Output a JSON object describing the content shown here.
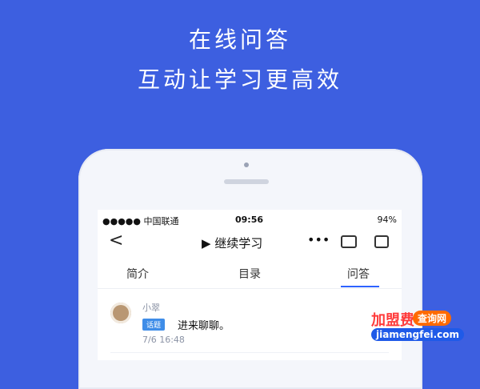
{
  "hero": {
    "line1": "在线问答",
    "line2": "互动让学习更高效"
  },
  "status_bar": {
    "carrier": "●●●●● 中国联通",
    "time": "09:56",
    "right": "94%"
  },
  "nav": {
    "back": "<",
    "play_title": "▶ 继续学习",
    "more": "•••"
  },
  "tabs": [
    "简介",
    "目录",
    "问答"
  ],
  "post": {
    "author": "小翠",
    "tag": "话题",
    "content": "进来聊聊。",
    "datetime": "7/6  16:48"
  },
  "watermark": {
    "top_text": "加盟费",
    "pill_text": "查询网",
    "bottom_text": "jiamengfei.com"
  },
  "colors": {
    "background": "#3d5fe0",
    "accent": "#2e63ff",
    "tag": "#3f8de8"
  },
  "icons": {
    "back": "back-icon",
    "more": "more-icon",
    "chat": "chat-icon",
    "share": "share-icon",
    "play": "play-icon",
    "wifi": "wifi-icon",
    "battery": "battery-icon"
  }
}
